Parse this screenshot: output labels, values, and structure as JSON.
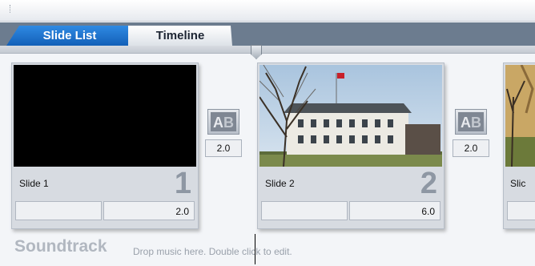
{
  "tabs": [
    {
      "label": "Slide List",
      "active": true
    },
    {
      "label": "Timeline",
      "active": false
    }
  ],
  "slides": [
    {
      "label": "Slide 1",
      "number": "1",
      "duration_left": "",
      "duration_right": "2.0",
      "thumbnail": "black-frame"
    },
    {
      "label": "Slide 2",
      "number": "2",
      "duration_left": "",
      "duration_right": "6.0",
      "thumbnail": "white-manor-house-photo"
    },
    {
      "label": "Slic",
      "number": "",
      "duration_left": "",
      "duration_right": "",
      "thumbnail": "autumn-trees-photo"
    }
  ],
  "transitions": [
    {
      "icon": "ab-transition-icon",
      "duration": "2.0"
    },
    {
      "icon": "ab-transition-icon",
      "duration": "2.0"
    }
  ],
  "soundtrack": {
    "title": "Soundtrack",
    "hint": "Drop music here.  Double click to edit."
  },
  "colors": {
    "active_tab": "#1f73cf",
    "tab_bar": "#6c7c8f",
    "slide_number": "#8e97a3"
  }
}
